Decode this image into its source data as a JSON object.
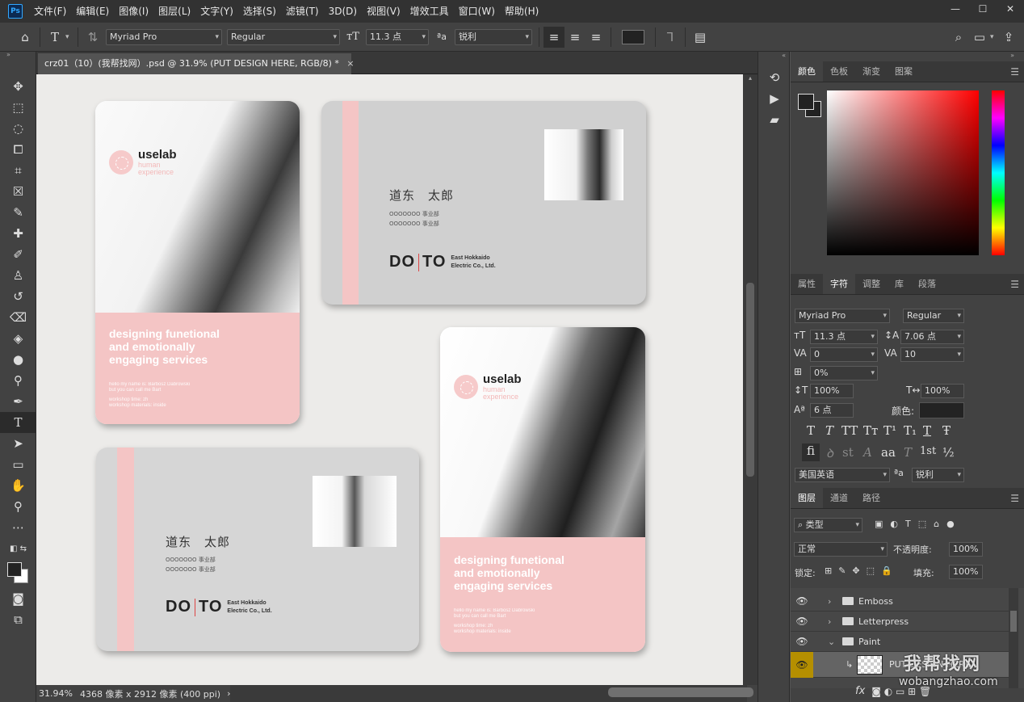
{
  "menubar": {
    "logo": "Ps",
    "items": [
      "文件(F)",
      "编辑(E)",
      "图像(I)",
      "图层(L)",
      "文字(Y)",
      "选择(S)",
      "滤镜(T)",
      "3D(D)",
      "视图(V)",
      "增效工具",
      "窗口(W)",
      "帮助(H)"
    ]
  },
  "options": {
    "font_family": "Myriad Pro",
    "font_style": "Regular",
    "font_size": "11.3 点",
    "aa_icon": "ªa",
    "antialias": "锐利"
  },
  "document": {
    "tab_title": "crz01（10）(我帮找网）.psd @ 31.9% (PUT DESIGN HERE, RGB/8) *",
    "close": "×"
  },
  "cards": {
    "brand": "uselab",
    "brand_sub1": "human",
    "brand_sub2": "experience",
    "tagline1": "designing funetional",
    "tagline2": "and emotionally",
    "tagline3": "engaging services",
    "small1": "hello my name is: Barbosz Dabrowski",
    "small2": "but you can call me Bart",
    "small3": "workshop time: zh",
    "small4": "workshop materials: inside",
    "person_name": "道东　太郎",
    "line1": "OOOOOOO 事业部",
    "line2": "OOOOOOO 事业部",
    "do": "DO",
    "to": "TO",
    "company1": "East Hokkaido",
    "company2": "Electric Co., Ltd."
  },
  "status": {
    "zoom": "31.94%",
    "info": "4368 像素 x 2912 像素 (400 ppi)",
    "arrow": "›"
  },
  "color_panel": {
    "tabs": [
      "颜色",
      "色板",
      "渐变",
      "图案"
    ],
    "active": 0
  },
  "char_panel": {
    "tabs": [
      "属性",
      "字符",
      "调整",
      "库",
      "段落"
    ],
    "font_family": "Myriad Pro",
    "font_style": "Regular",
    "size": "11.3 点",
    "leading": "7.06 点",
    "kerning": "0",
    "tracking": "10",
    "scale_percent": "0%",
    "vscale": "100%",
    "hscale": "100%",
    "baseline": "6 点",
    "color_label": "颜色:",
    "language": "美国英语",
    "aa_icon": "ªa",
    "antialias": "锐利",
    "glyphs1": [
      "T",
      "T",
      "TT",
      "Tт",
      "T¹",
      "T₁",
      "T",
      "Ŧ"
    ],
    "glyphs2": [
      "fi",
      "ꝺ",
      "st",
      "A",
      "aa",
      "T",
      "1st",
      "½"
    ]
  },
  "layers_panel": {
    "tabs": [
      "图层",
      "通道",
      "路径"
    ],
    "filter": "类型",
    "blend_mode": "正常",
    "opacity_label": "不透明度:",
    "opacity": "100%",
    "lock_label": "锁定:",
    "fill_label": "填充:",
    "fill": "100%",
    "layers": [
      {
        "name": "Emboss",
        "type": "folder",
        "open": false
      },
      {
        "name": "Letterpress",
        "type": "folder",
        "open": false
      },
      {
        "name": "Paint",
        "type": "folder",
        "open": true
      },
      {
        "name": "PUT DESIGN HERE",
        "type": "smart",
        "selected": true
      }
    ],
    "bottom": "fx",
    "watermark": "我帮找网",
    "watermark_url": "wobangzhao.com"
  },
  "colors": {
    "accent_pink": "#f4c5c5",
    "panel_bg": "#424242"
  }
}
